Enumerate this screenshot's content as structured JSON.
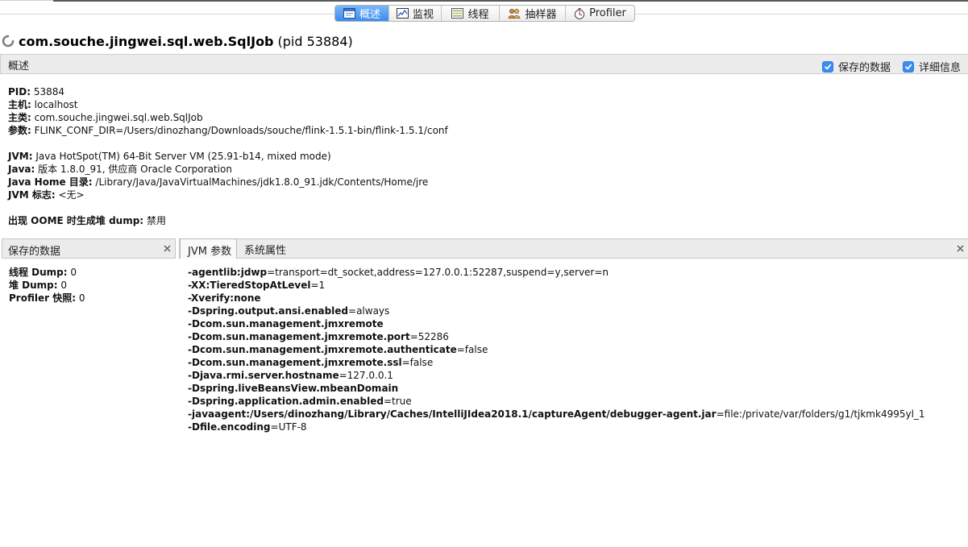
{
  "tabs": [
    {
      "label": "概述",
      "icon": "overview-icon",
      "selected": true
    },
    {
      "label": "监视",
      "icon": "monitor-icon",
      "selected": false
    },
    {
      "label": "线程",
      "icon": "threads-icon",
      "selected": false
    },
    {
      "label": "抽样器",
      "icon": "sampler-icon",
      "selected": false
    },
    {
      "label": "Profiler",
      "icon": "profiler-icon",
      "selected": false
    }
  ],
  "app": {
    "status_icon": "loading-spinner-icon",
    "name": "com.souche.jingwei.sql.web.SqlJob",
    "pid": "(pid 53884)"
  },
  "overview": {
    "title": "概述",
    "options": [
      {
        "label": "保存的数据",
        "checked": true
      },
      {
        "label": "详细信息",
        "checked": true
      }
    ],
    "process": [
      {
        "label": "PID:",
        "value": "53884"
      },
      {
        "label": "主机:",
        "value": "localhost"
      },
      {
        "label": "主类:",
        "value": "com.souche.jingwei.sql.web.SqlJob"
      },
      {
        "label": "参数:",
        "value": "FLINK_CONF_DIR=/Users/dinozhang/Downloads/souche/flink-1.5.1-bin/flink-1.5.1/conf"
      }
    ],
    "jvm": [
      {
        "label": "JVM:",
        "value": "Java HotSpot(TM) 64-Bit Server VM (25.91-b14, mixed mode)"
      },
      {
        "label": "Java:",
        "value": "版本 1.8.0_91, 供应商 Oracle Corporation"
      },
      {
        "label": "Java Home 目录:",
        "value": "/Library/Java/JavaVirtualMachines/jdk1.8.0_91.jdk/Contents/Home/jre"
      },
      {
        "label": "JVM 标志:",
        "value": "<无>"
      }
    ],
    "oome": {
      "label": "出现 OOME 时生成堆 dump:",
      "value": "禁用"
    }
  },
  "saved_data": {
    "title": "保存的数据",
    "close_icon": "close-icon",
    "items": [
      {
        "label": "线程 Dump:",
        "value": "0"
      },
      {
        "label": "堆 Dump:",
        "value": "0"
      },
      {
        "label": "Profiler 快照:",
        "value": "0"
      }
    ]
  },
  "jvm_panel": {
    "close_icon": "close-icon",
    "tabs": [
      {
        "label": "JVM 参数",
        "selected": true
      },
      {
        "label": "系统属性",
        "selected": false
      }
    ],
    "args": [
      {
        "name": "-agentlib:jdwp",
        "value": "=transport=dt_socket,address=127.0.0.1:52287,suspend=y,server=n"
      },
      {
        "name": "-XX:TieredStopAtLevel",
        "value": "=1"
      },
      {
        "name": "-Xverify:none"
      },
      {
        "name": "-Dspring.output.ansi.enabled",
        "value": "=always"
      },
      {
        "name": "-Dcom.sun.management.jmxremote"
      },
      {
        "name": "-Dcom.sun.management.jmxremote.port",
        "value": "=52286"
      },
      {
        "name": "-Dcom.sun.management.jmxremote.authenticate",
        "value": "=false"
      },
      {
        "name": "-Dcom.sun.management.jmxremote.ssl",
        "value": "=false"
      },
      {
        "name": "-Djava.rmi.server.hostname",
        "value": "=127.0.0.1"
      },
      {
        "name": "-Dspring.liveBeansView.mbeanDomain"
      },
      {
        "name": "-Dspring.application.admin.enabled",
        "value": "=true"
      },
      {
        "name": "-javaagent:/Users/dinozhang/Library/Caches/IntelliJIdea2018.1/captureAgent/debugger-agent.jar",
        "value": "=file:/private/var/folders/g1/tjkmk4995yl_1"
      },
      {
        "name": "-Dfile.encoding",
        "value": "=UTF-8"
      }
    ]
  },
  "colors": {
    "accent": "#3a8cef"
  }
}
